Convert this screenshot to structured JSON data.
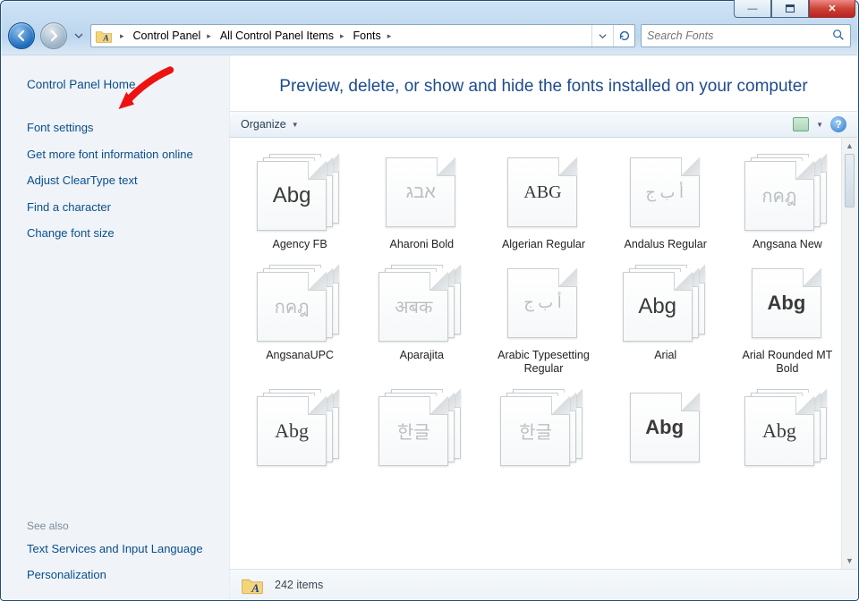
{
  "breadcrumb": [
    "Control Panel",
    "All Control Panel Items",
    "Fonts"
  ],
  "search": {
    "placeholder": "Search Fonts"
  },
  "sidebar": {
    "home": "Control Panel Home",
    "links": [
      "Font settings",
      "Get more font information online",
      "Adjust ClearType text",
      "Find a character",
      "Change font size"
    ],
    "see_also_header": "See also",
    "see_also": [
      "Text Services and Input Language",
      "Personalization"
    ]
  },
  "heading": "Preview, delete, or show and hide the fonts installed on your computer",
  "commandbar": {
    "organize": "Organize"
  },
  "fonts": [
    {
      "name": "Agency FB",
      "sample": "Abg",
      "stack": true,
      "dim": false,
      "font": "'Agency FB', sans-serif",
      "fs": 24
    },
    {
      "name": "Aharoni Bold",
      "sample": "אבג",
      "stack": false,
      "dim": true,
      "font": "sans-serif",
      "fs": 20
    },
    {
      "name": "Algerian Regular",
      "sample": "ABG",
      "stack": false,
      "dim": false,
      "font": "'Algerian', serif",
      "fs": 20,
      "ls": 0
    },
    {
      "name": "Andalus Regular",
      "sample": "أ ب ج",
      "stack": false,
      "dim": true,
      "font": "serif",
      "fs": 18
    },
    {
      "name": "Angsana New",
      "sample": "กคฎ",
      "stack": true,
      "dim": true,
      "font": "serif",
      "fs": 20
    },
    {
      "name": "AngsanaUPC",
      "sample": "กคฎ",
      "stack": true,
      "dim": true,
      "font": "serif",
      "fs": 20
    },
    {
      "name": "Aparajita",
      "sample": "अबक",
      "stack": true,
      "dim": true,
      "font": "serif",
      "fs": 20
    },
    {
      "name": "Arabic Typesetting Regular",
      "sample": "أ ب ج",
      "stack": false,
      "dim": true,
      "font": "serif",
      "fs": 18
    },
    {
      "name": "Arial",
      "sample": "Abg",
      "stack": true,
      "dim": false,
      "font": "Arial, sans-serif",
      "fs": 24
    },
    {
      "name": "Arial Rounded MT Bold",
      "sample": "Abg",
      "stack": false,
      "dim": false,
      "font": "'Arial Rounded MT Bold', Arial, sans-serif",
      "fs": 22,
      "fw": 700
    },
    {
      "name": "",
      "sample": "Abg",
      "stack": true,
      "dim": false,
      "font": "Georgia, serif",
      "fs": 22
    },
    {
      "name": "",
      "sample": "한글",
      "stack": true,
      "dim": true,
      "font": "sans-serif",
      "fs": 20
    },
    {
      "name": "",
      "sample": "한글",
      "stack": true,
      "dim": true,
      "font": "sans-serif",
      "fs": 20
    },
    {
      "name": "",
      "sample": "Abg",
      "stack": false,
      "dim": false,
      "font": "'Bauhaus 93', sans-serif",
      "fs": 22,
      "fw": 900
    },
    {
      "name": "",
      "sample": "Abg",
      "stack": true,
      "dim": false,
      "font": "Georgia, serif",
      "fs": 22
    }
  ],
  "status": {
    "count": "242 items"
  }
}
